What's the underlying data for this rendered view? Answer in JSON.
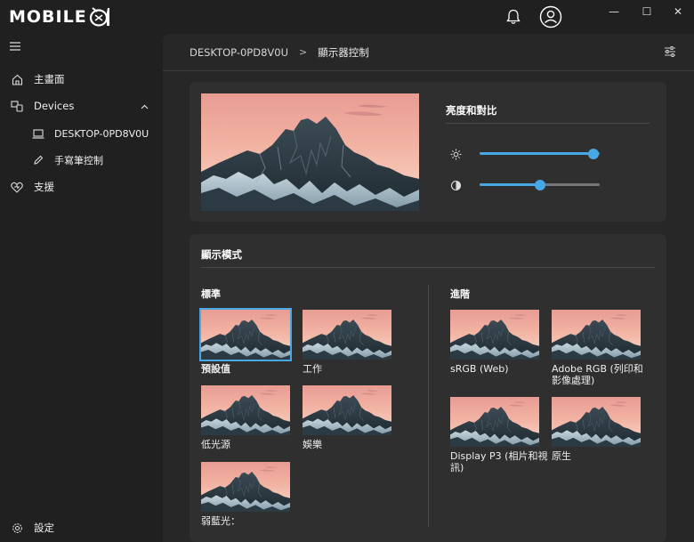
{
  "app": {
    "logo_text": "MOBILE",
    "logo_icon": "mobile01-logo-icon"
  },
  "titlebar": {
    "bell_icon": "bell-icon",
    "account_icon": "user-account-icon",
    "minimize": "—",
    "maximize": "☐",
    "close": "✕"
  },
  "sidebar": {
    "menu_icon": "hamburger-icon",
    "items": [
      {
        "label": "主畫面",
        "icon": "home-icon"
      },
      {
        "label": "Devices",
        "icon": "devices-icon"
      },
      {
        "label": "DESKTOP-0PD8V0U",
        "icon": "laptop-icon"
      },
      {
        "label": "手寫筆控制",
        "icon": "pen-icon"
      },
      {
        "label": "支援",
        "icon": "heart-support-icon"
      }
    ],
    "settings": {
      "label": "設定",
      "icon": "gear-icon"
    }
  },
  "header": {
    "breadcrumb": [
      "DESKTOP-0PD8V0U",
      "顯示器控制"
    ],
    "separator": ">",
    "filter_icon": "sliders-icon"
  },
  "brightness_contrast": {
    "title": "亮度和對比",
    "brightness": {
      "icon": "sun-icon",
      "value": 0.95
    },
    "contrast": {
      "icon": "contrast-icon",
      "value": 0.5
    }
  },
  "display_mode": {
    "title": "顯示模式",
    "standard": {
      "title": "標準",
      "modes": [
        {
          "label": "預設值",
          "selected": true
        },
        {
          "label": "工作",
          "selected": false
        },
        {
          "label": "低光源",
          "selected": false
        },
        {
          "label": "娛樂",
          "selected": false
        },
        {
          "label": "弱藍光：",
          "selected": false
        }
      ]
    },
    "advanced": {
      "title": "進階",
      "modes": [
        {
          "label": "sRGB (Web)"
        },
        {
          "label": "Adobe RGB (列印和影像處理)"
        },
        {
          "label": "Display P3 (相片和視訊)"
        },
        {
          "label": "原生"
        }
      ]
    }
  },
  "colors": {
    "accent": "#48a8e6",
    "background": "#202020",
    "panel": "#272727",
    "card": "#2f2f2f"
  }
}
